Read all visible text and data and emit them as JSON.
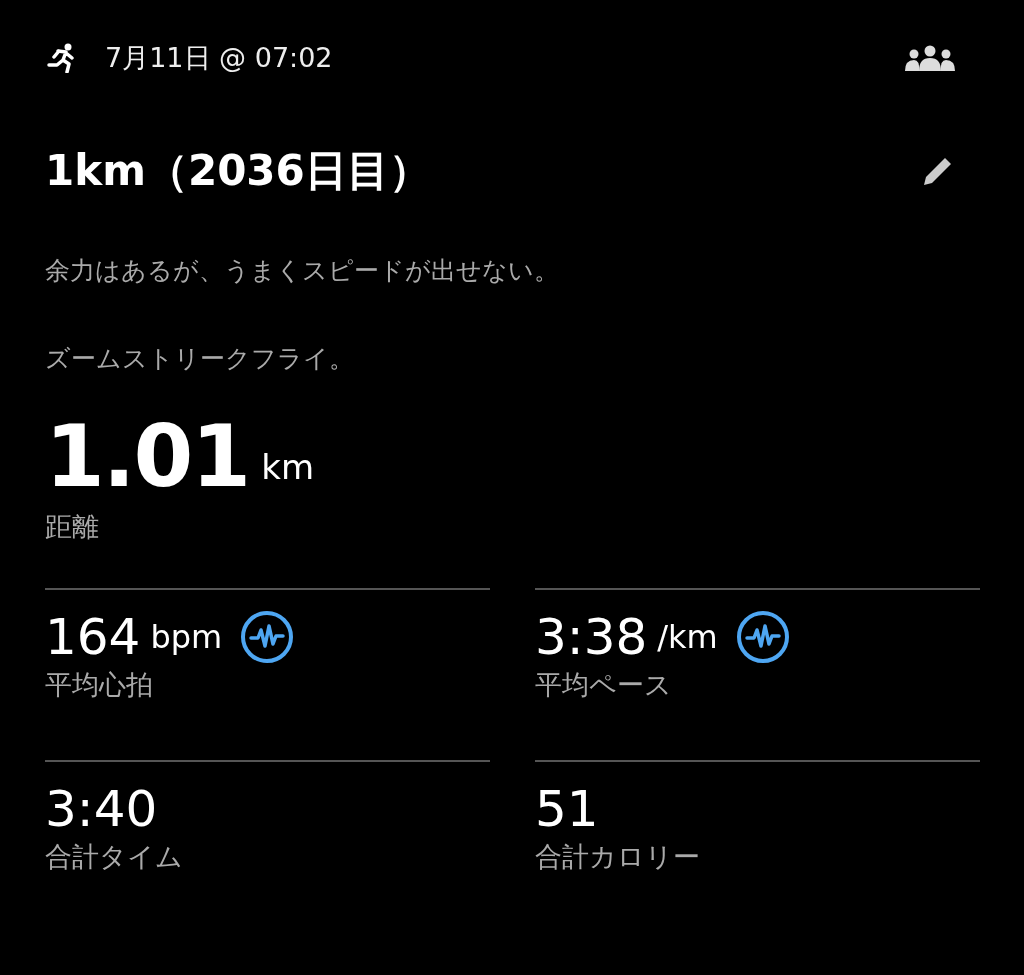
{
  "header": {
    "date": "7月11日 @ 07:02"
  },
  "title": "1km（2036日目）",
  "notes": [
    "余力はあるが、うまくスピードが出せない。",
    "ズームストリークフライ。"
  ],
  "distance": {
    "value": "1.01",
    "unit": "km",
    "label": "距離"
  },
  "stats": [
    {
      "value": "164",
      "unit": "bpm",
      "label": "平均心拍",
      "detail_icon": true
    },
    {
      "value": "3:38",
      "unit": "/km",
      "label": "平均ペース",
      "detail_icon": true
    },
    {
      "value": "3:40",
      "label": "合計タイム",
      "detail_icon": false
    },
    {
      "value": "51",
      "label": "合計カロリー",
      "detail_icon": false
    }
  ]
}
